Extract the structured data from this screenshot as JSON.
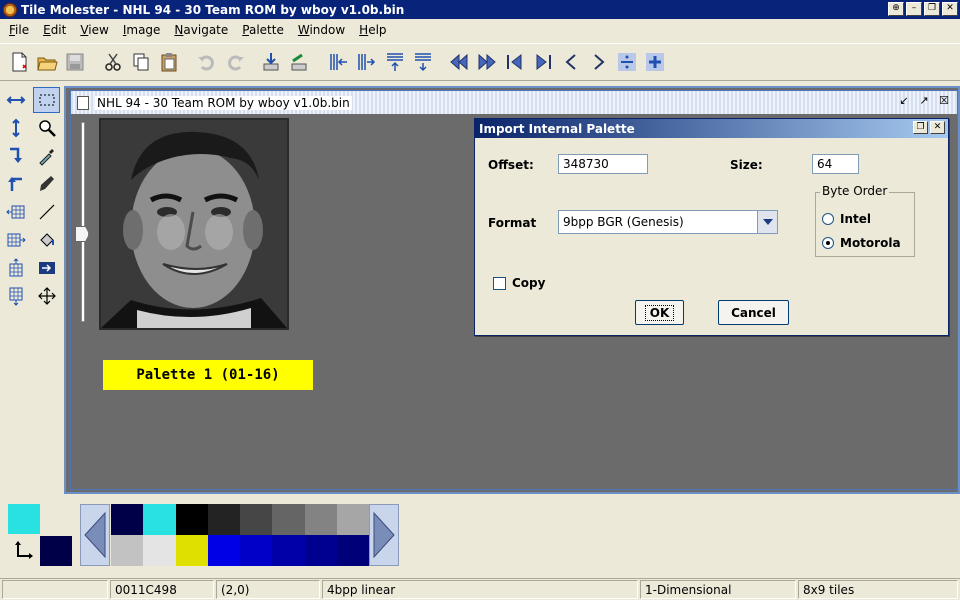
{
  "window": {
    "title": "Tile Molester - NHL 94 - 30 Team ROM by wboy v1.0b.bin"
  },
  "menu": {
    "items": [
      {
        "label": "File",
        "key": "F",
        "rest": "ile"
      },
      {
        "label": "Edit",
        "key": "E",
        "rest": "dit"
      },
      {
        "label": "View",
        "key": "V",
        "rest": "iew"
      },
      {
        "label": "Image",
        "key": "I",
        "rest": "mage"
      },
      {
        "label": "Navigate",
        "key": "N",
        "rest": "avigate"
      },
      {
        "label": "Palette",
        "key": "P",
        "rest": "alette"
      },
      {
        "label": "Window",
        "key": "W",
        "rest": "indow"
      },
      {
        "label": "Help",
        "key": "H",
        "rest": "elp"
      }
    ]
  },
  "document": {
    "title": "NHL 94 - 30 Team ROM by wboy v1.0b.bin",
    "palette_label": "Palette 1 (01-16)"
  },
  "dialog": {
    "title": "Import Internal Palette",
    "offset_label": "Offset:",
    "offset_value": "348730",
    "size_label": "Size:",
    "size_value": "64",
    "format_label": "Format",
    "format_value": "9bpp BGR (Genesis)",
    "byte_order_label": "Byte Order",
    "intel_label": "Intel",
    "motorola_label": "Motorola",
    "selected_byte_order": "Motorola",
    "copy_label": "Copy",
    "copy_checked": false,
    "ok_label": "OK",
    "cancel_label": "Cancel"
  },
  "palette_panel": {
    "foreground_color": "#29e1e1",
    "background_color": "#000048",
    "swatches": [
      "#000048",
      "#29e1e1",
      "#000000",
      "#232323",
      "#464646",
      "#656565",
      "#838383",
      "#a6a6a6",
      "#c2c2c2",
      "#e4e4e4",
      "#e0e000",
      "#0000e6",
      "#0000c8",
      "#0000a8",
      "#000090",
      "#000078"
    ]
  },
  "status": {
    "offset": "0011C498",
    "coords": "(2,0)",
    "codec": "4bpp linear",
    "mode": "1-Dimensional",
    "tiles": "8x9 tiles"
  },
  "colors": {
    "titlebar": "#08247a",
    "highlight": "#ffff00",
    "canvas_bg": "#6b6b6b"
  }
}
